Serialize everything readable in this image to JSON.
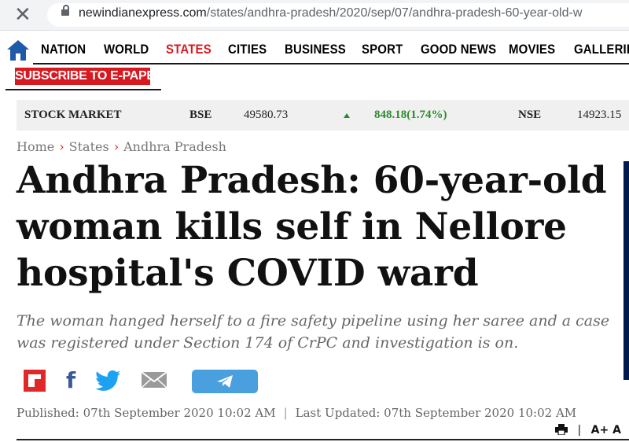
{
  "browser": {
    "close_glyph": "✕",
    "url_domain": "newindianexpress.com",
    "url_path": "/states/andhra-pradesh/2020/sep/07/andhra-pradesh-60-year-old-w"
  },
  "nav": {
    "items": [
      "NATION",
      "WORLD",
      "STATES",
      "CITIES",
      "BUSINESS",
      "SPORT",
      "GOOD NEWS",
      "MOVIES",
      "GALLERIES"
    ],
    "active": "STATES",
    "accent_color": "#d71920"
  },
  "subscribe_label": "SUBSCRIBE TO E-PAPER",
  "stock": {
    "label": "STOCK MARKET",
    "bse_label": "BSE",
    "bse_value": "49580.73",
    "bse_change": "848.18(1.74%)",
    "nse_label": "NSE",
    "nse_value": "14923.15"
  },
  "breadcrumb": {
    "items": [
      "Home",
      "States",
      "Andhra Pradesh"
    ],
    "sep": "›"
  },
  "article": {
    "headline": "Andhra Pradesh: 60-year-old woman kills self in Nellore hospital's COVID ward",
    "summary": "The woman hanged herself to a fire safety pipeline using her saree and a case was registered under Section 174 of CrPC and investigation is on.",
    "published": "Published: 07th September 2020 10:02 AM",
    "updated": "Last Updated: 07th September 2020 10:02 AM",
    "meta_sep": "|"
  },
  "share_icons": [
    "flipboard-icon",
    "facebook-icon",
    "twitter-icon",
    "email-icon",
    "telegram-icon"
  ],
  "tools": {
    "font_size_label": "A+ A",
    "sep": "|"
  }
}
